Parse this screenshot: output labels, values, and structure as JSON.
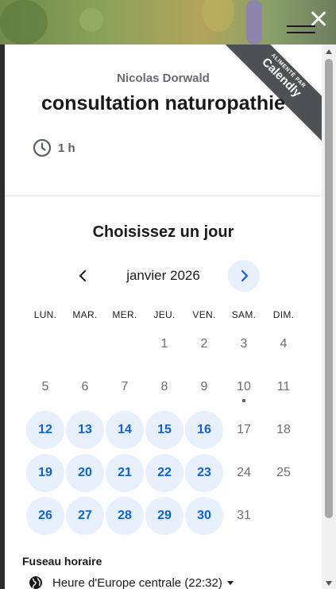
{
  "window": {
    "close_icon": "close-icon",
    "menu_icon": "hamburger-icon"
  },
  "ribbon": {
    "small": "ALIMENTÉ PAR",
    "brand": "Calendly"
  },
  "event": {
    "host": "Nicolas Dorwald",
    "title": "consultation naturopathie",
    "duration": "1 h",
    "duration_icon": "clock-icon"
  },
  "calendar": {
    "heading": "Choisissez un jour",
    "month": "janvier 2026",
    "weekdays": [
      "LUN.",
      "MAR.",
      "MER.",
      "JEU.",
      "VEN.",
      "SAM.",
      "DIM."
    ],
    "leading_blanks": 3,
    "today": 10,
    "days": [
      {
        "n": "1",
        "available": false
      },
      {
        "n": "2",
        "available": false
      },
      {
        "n": "3",
        "available": false
      },
      {
        "n": "4",
        "available": false
      },
      {
        "n": "5",
        "available": false
      },
      {
        "n": "6",
        "available": false
      },
      {
        "n": "7",
        "available": false
      },
      {
        "n": "8",
        "available": false
      },
      {
        "n": "9",
        "available": false
      },
      {
        "n": "10",
        "available": false
      },
      {
        "n": "11",
        "available": false
      },
      {
        "n": "12",
        "available": true
      },
      {
        "n": "13",
        "available": true
      },
      {
        "n": "14",
        "available": true
      },
      {
        "n": "15",
        "available": true
      },
      {
        "n": "16",
        "available": true
      },
      {
        "n": "17",
        "available": false
      },
      {
        "n": "18",
        "available": false
      },
      {
        "n": "19",
        "available": true
      },
      {
        "n": "20",
        "available": true
      },
      {
        "n": "21",
        "available": true
      },
      {
        "n": "22",
        "available": true
      },
      {
        "n": "23",
        "available": true
      },
      {
        "n": "24",
        "available": false
      },
      {
        "n": "25",
        "available": false
      },
      {
        "n": "26",
        "available": true
      },
      {
        "n": "27",
        "available": true
      },
      {
        "n": "28",
        "available": true
      },
      {
        "n": "29",
        "available": true
      },
      {
        "n": "30",
        "available": true
      },
      {
        "n": "31",
        "available": false
      }
    ]
  },
  "timezone": {
    "label": "Fuseau horaire",
    "value": "Heure d'Europe centrale (22:32)",
    "icon": "globe-icon"
  },
  "colors": {
    "accent": "#0b63d9",
    "accent_bg": "#e8f0fd",
    "ribbon": "#4d5055"
  }
}
